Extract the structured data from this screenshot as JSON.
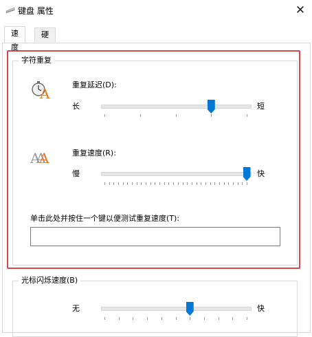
{
  "window": {
    "title": "键盘 属性"
  },
  "tabs": [
    {
      "label": "速度"
    },
    {
      "label": "硬件"
    }
  ],
  "char_repeat": {
    "group_label": "字符重复",
    "delay": {
      "label": "重复延迟(D):",
      "left": "长",
      "right": "短",
      "value": 3,
      "max": 4
    },
    "rate": {
      "label": "重复速度(R):",
      "left": "慢",
      "right": "快",
      "value": 31,
      "max": 31
    },
    "test": {
      "label": "单击此处并按住一个键以便测试重复速度(T):",
      "value": ""
    },
    "icon_letter": "A",
    "icon_letters_small": "AA"
  },
  "cursor_blink": {
    "group_label": "光标闪烁速度(B)",
    "left": "无",
    "right": "快",
    "value": 0.6
  },
  "colors": {
    "accent": "#0078d7",
    "highlight": "#d9494b",
    "icon_orange": "#e07a2e"
  }
}
